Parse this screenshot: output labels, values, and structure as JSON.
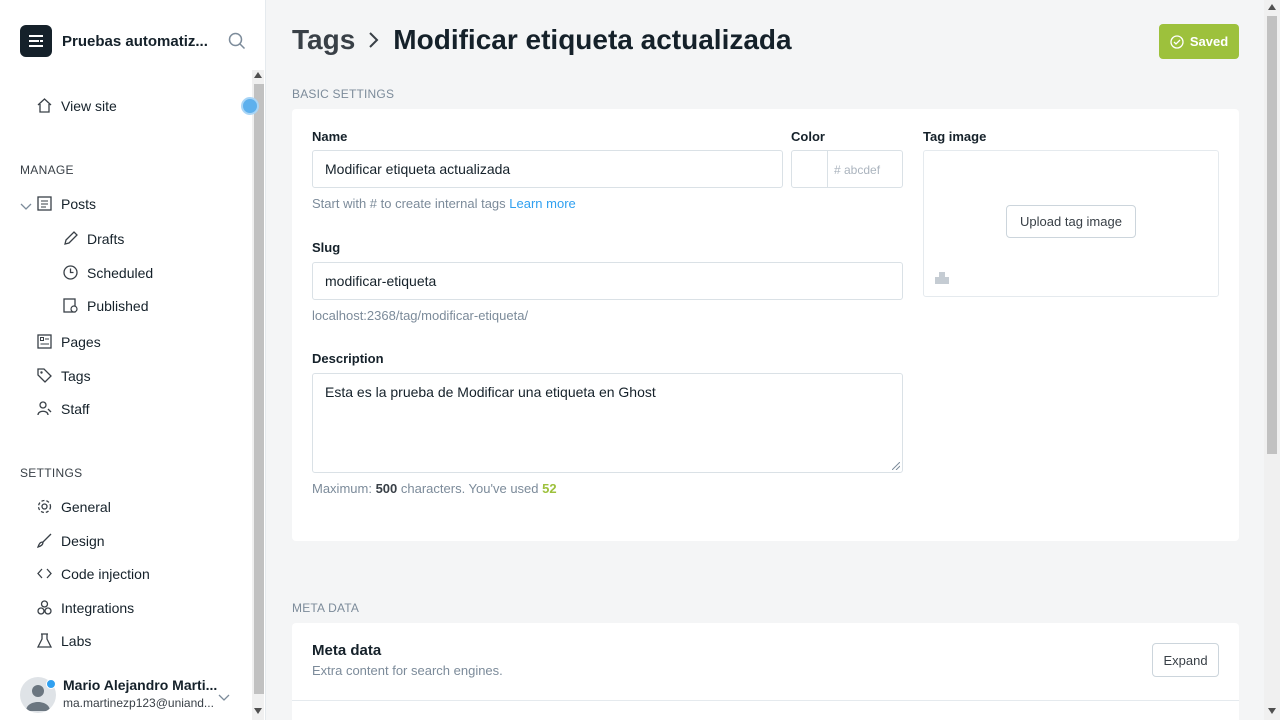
{
  "sidebar": {
    "site_name": "Pruebas automatiz...",
    "view_site": "View site",
    "manage_label": "MANAGE",
    "posts": "Posts",
    "drafts": "Drafts",
    "scheduled": "Scheduled",
    "published": "Published",
    "pages": "Pages",
    "tags": "Tags",
    "staff": "Staff",
    "settings_label": "SETTINGS",
    "general": "General",
    "design": "Design",
    "code_injection": "Code injection",
    "integrations": "Integrations",
    "labs": "Labs",
    "user_name": "Mario Alejandro Marti...",
    "user_email": "ma.martinezp123@uniand..."
  },
  "header": {
    "crumb_parent": "Tags",
    "crumb_current": "Modificar etiqueta actualizada",
    "saved_label": "Saved"
  },
  "basic": {
    "section_title": "BASIC SETTINGS",
    "name_label": "Name",
    "name_value": "Modificar etiqueta actualizada",
    "name_hint": "Start with # to create internal tags ",
    "learn_more": "Learn more",
    "color_label": "Color",
    "color_placeholder": "# abcdef",
    "tag_image_label": "Tag image",
    "upload_label": "Upload tag image",
    "slug_label": "Slug",
    "slug_value": "modificar-etiqueta",
    "slug_url": "localhost:2368/tag/modificar-etiqueta/",
    "description_label": "Description",
    "description_value": "Esta es la prueba de Modificar una etiqueta en Ghost",
    "max_prefix": "Maximum: ",
    "max_value": "500",
    "max_mid": " characters. You've used ",
    "used_value": "52"
  },
  "meta": {
    "section_title": "META DATA",
    "title": "Meta data",
    "subtitle": "Extra content for search engines.",
    "expand_label": "Expand"
  },
  "colors": {
    "accent_green": "#9dc13c",
    "link_blue": "#30a0f0"
  }
}
